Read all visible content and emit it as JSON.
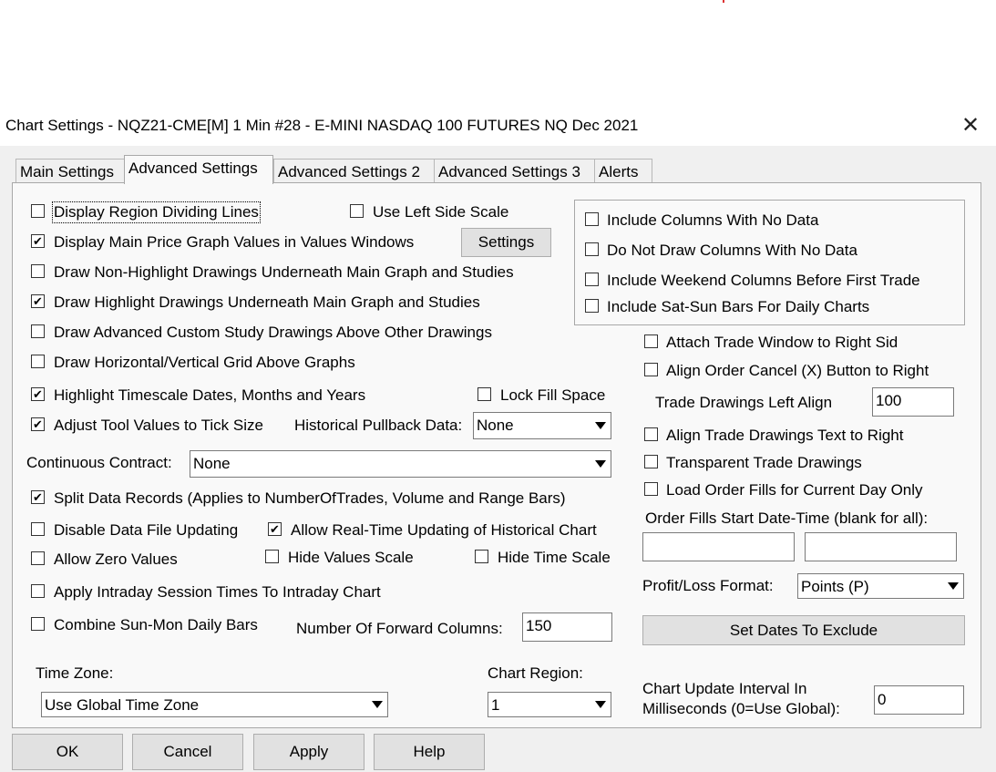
{
  "window": {
    "title": "Chart Settings - NQZ21-CME[M]  1 Min   #28 - E-MINI NASDAQ 100 FUTURES NQ Dec 2021",
    "close_icon": "close-icon"
  },
  "tabs": [
    "Main Settings",
    "Advanced Settings",
    "Advanced Settings 2",
    "Advanced Settings 3",
    "Alerts"
  ],
  "left": {
    "display_region_dividing_lines": {
      "label": "Display Region Dividing Lines",
      "checked": false
    },
    "use_left_side_scale": {
      "label": "Use Left Side Scale",
      "checked": false
    },
    "display_main_price_values": {
      "label": "Display Main Price Graph Values in Values Windows",
      "checked": true
    },
    "settings_button": "Settings",
    "draw_non_highlight": {
      "label": "Draw Non-Highlight Drawings Underneath Main Graph and Studies",
      "checked": false
    },
    "draw_highlight": {
      "label": "Draw Highlight Drawings Underneath Main Graph and Studies",
      "checked": true
    },
    "draw_advanced_custom": {
      "label": "Draw Advanced Custom Study Drawings Above Other Drawings",
      "checked": false
    },
    "draw_grid_above": {
      "label": "Draw Horizontal/Vertical Grid Above Graphs",
      "checked": false
    },
    "highlight_timescale": {
      "label": "Highlight Timescale Dates, Months and Years",
      "checked": true
    },
    "lock_fill_space": {
      "label": "Lock Fill Space",
      "checked": false
    },
    "adjust_tool_values": {
      "label": "Adjust Tool Values to Tick Size",
      "checked": true
    },
    "historical_pullback_label": "Historical Pullback Data:",
    "historical_pullback_value": "None",
    "continuous_contract_label": "Continuous Contract:",
    "continuous_contract_value": "None",
    "split_data_records": {
      "label": "Split Data Records (Applies to NumberOfTrades, Volume and Range Bars)",
      "checked": true
    },
    "disable_data_file_updating": {
      "label": "Disable Data File Updating",
      "checked": false
    },
    "allow_realtime_updating": {
      "label": "Allow Real-Time Updating of Historical Chart",
      "checked": true
    },
    "allow_zero_values": {
      "label": "Allow Zero Values",
      "checked": false
    },
    "hide_values_scale": {
      "label": "Hide Values Scale",
      "checked": false
    },
    "hide_time_scale": {
      "label": "Hide Time Scale",
      "checked": false
    },
    "apply_intraday_session": {
      "label": "Apply Intraday Session Times To Intraday Chart",
      "checked": false
    },
    "combine_sun_mon": {
      "label": "Combine Sun-Mon Daily Bars",
      "checked": false
    },
    "forward_columns_label": "Number Of Forward Columns:",
    "forward_columns_value": "150",
    "time_zone_label": "Time Zone:",
    "time_zone_value": "Use Global Time Zone",
    "chart_region_label": "Chart Region:",
    "chart_region_value": "1"
  },
  "right": {
    "include_columns_no_data": {
      "label": "Include Columns With No Data",
      "checked": false
    },
    "do_not_draw_columns": {
      "label": "Do Not Draw Columns With No Data",
      "checked": false
    },
    "include_weekend_columns": {
      "label": "Include Weekend Columns Before First Trade",
      "checked": false
    },
    "include_sat_sun": {
      "label": "Include Sat-Sun Bars For Daily Charts",
      "checked": false
    },
    "attach_trade_window": {
      "label": "Attach Trade Window to Right Sid",
      "checked": false
    },
    "align_order_cancel": {
      "label": "Align Order Cancel (X) Button to Right",
      "checked": false
    },
    "trade_drawings_left_align_label": "Trade Drawings Left Align",
    "trade_drawings_left_align_value": "100",
    "align_trade_drawings_text": {
      "label": "Align Trade Drawings Text to Right",
      "checked": false
    },
    "transparent_trade_drawings": {
      "label": "Transparent Trade Drawings",
      "checked": false
    },
    "load_order_fills": {
      "label": "Load Order Fills for Current Day Only",
      "checked": false
    },
    "order_fills_start_label": "Order Fills Start Date-Time (blank for all):",
    "order_fills_start_value_1": "",
    "order_fills_start_value_2": "",
    "profit_loss_label": "Profit/Loss Format:",
    "profit_loss_value": "Points (P)",
    "set_dates_button": "Set Dates To Exclude",
    "update_interval_label_1": "Chart Update Interval In",
    "update_interval_label_2": "Milliseconds (0=Use Global):",
    "update_interval_value": "0"
  },
  "buttons": {
    "ok": "OK",
    "cancel": "Cancel",
    "apply": "Apply",
    "help": "Help"
  }
}
